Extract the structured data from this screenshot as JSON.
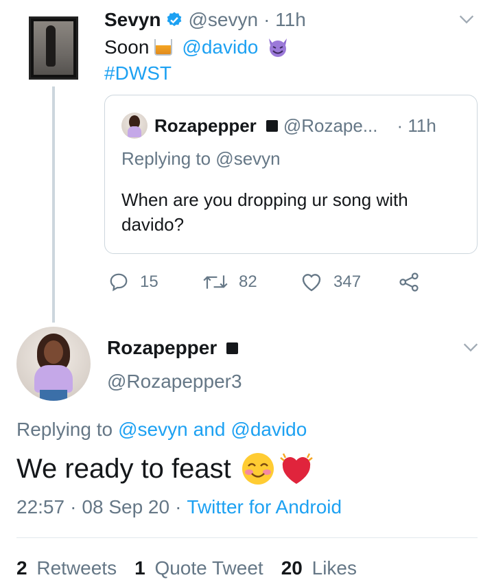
{
  "parent_tweet": {
    "display_name": "Sevyn",
    "handle": "@sevyn",
    "time": "· 11h",
    "text_prefix": "Soon",
    "mention": "@davido",
    "hashtag": "#DWST",
    "verified_color": "#1da1f2",
    "quoted": {
      "display_name": "Rozapepper",
      "handle": "@Rozape...",
      "time": "· 11h",
      "replying_to": "Replying to @sevyn",
      "text": "When are you dropping ur song with davido?"
    },
    "actions": {
      "replies": "15",
      "retweets": "82",
      "likes": "347"
    }
  },
  "main_tweet": {
    "display_name": "Rozapepper",
    "handle": "@Rozapepper3",
    "replying_label": "Replying to",
    "replying_user1": "@sevyn",
    "replying_and": "and",
    "replying_user2": "@davido",
    "text": "We ready to feast",
    "time": "22:57",
    "separator1": "·",
    "date": "08 Sep 20",
    "separator2": "·",
    "source": "Twitter for Android"
  },
  "stats": {
    "retweets_count": "2",
    "retweets_label": "Retweets",
    "quotes_count": "1",
    "quotes_label": "Quote Tweet",
    "likes_count": "20",
    "likes_label": "Likes"
  },
  "colors": {
    "link": "#1da1f2",
    "secondary_text": "#657786",
    "border": "#ccd6dd"
  }
}
